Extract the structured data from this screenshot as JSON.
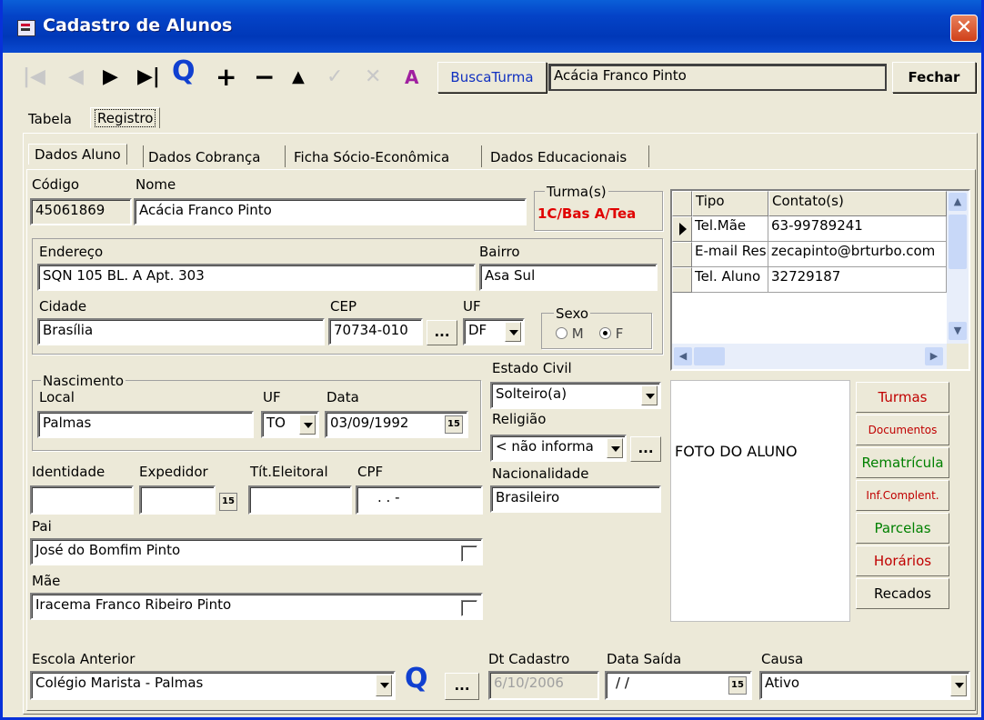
{
  "window": {
    "title": "Cadastro de Alunos",
    "close_glyph": "✕"
  },
  "toolbar": {
    "first": "|◀",
    "prev": "◀",
    "next": "▶",
    "last": "▶|",
    "search_glyph": "Q",
    "add": "+",
    "remove": "−",
    "edit": "▲",
    "confirm": "✓",
    "cancel": "✕",
    "font": "A",
    "busca_turma": "BuscaTurma",
    "current_student": "Acácia Franco Pinto",
    "fechar": "Fechar"
  },
  "view_tabs": {
    "tabela": "Tabela",
    "registro": "Registro"
  },
  "tabs": [
    "Dados Aluno",
    "Dados Cobrança",
    "Ficha Sócio-Econômica",
    "Dados Educacionais"
  ],
  "aluno": {
    "codigo_label": "Código",
    "codigo": "45061869",
    "nome_label": "Nome",
    "nome": "Acácia Franco Pinto",
    "turma_label": "Turma(s)",
    "turma": "1C/Bas A/Tea",
    "endereco_label": "Endereço",
    "endereco": "SQN 105 BL. A Apt. 303",
    "bairro_label": "Bairro",
    "bairro": "Asa Sul",
    "cidade_label": "Cidade",
    "cidade": "Brasília",
    "cep_label": "CEP",
    "cep": "70734-010",
    "uf_label": "UF",
    "uf": "DF",
    "sexo_label": "Sexo",
    "sexo_m": "M",
    "sexo_f": "F",
    "nascimento_label": "Nascimento",
    "local_label": "Local",
    "local": "Palmas",
    "nasc_uf_label": "UF",
    "nasc_uf": "TO",
    "data_label": "Data",
    "data": "03/09/1992",
    "estado_civil_label": "Estado Civil",
    "estado_civil": "Solteiro(a)",
    "religiao_label": "Religião",
    "religiao": "< não informa",
    "identidade_label": "Identidade",
    "identidade": "",
    "expedidor_label": "Expedidor",
    "expedidor": "",
    "titulo_label": "Tít.Eleitoral",
    "titulo": "",
    "cpf_label": "CPF",
    "cpf": ". . -",
    "nacionalidade_label": "Nacionalidade",
    "nacionalidade": "Brasileiro",
    "pai_label": "Pai",
    "pai": "José do Bomfim Pinto",
    "mae_label": "Mãe",
    "mae": "Iracema Franco Ribeiro Pinto",
    "escola_label": "Escola Anterior",
    "escola": "Colégio Marista - Palmas",
    "dt_cadastro_label": "Dt Cadastro",
    "dt_cadastro": "6/10/2006",
    "data_saida_label": "Data Saída",
    "data_saida": "/ /",
    "causa_label": "Causa",
    "causa": "Ativo",
    "dots": "...",
    "cal": "15"
  },
  "contacts": {
    "col_tipo": "Tipo",
    "col_contato": "Contato(s)",
    "rows": [
      {
        "tipo": "Tel.Mãe",
        "contato": "63-99789241"
      },
      {
        "tipo": "E-mail Res",
        "contato": "zecapinto@brturbo.com"
      },
      {
        "tipo": "Tel. Aluno",
        "contato": "32729187"
      }
    ]
  },
  "foto": {
    "label": "FOTO DO ALUNO"
  },
  "side_buttons": [
    {
      "label": "Turmas",
      "color": "#c00000",
      "small": false
    },
    {
      "label": "Documentos",
      "color": "#c00000",
      "small": true
    },
    {
      "label": "Rematrícula",
      "color": "#008000",
      "small": false
    },
    {
      "label": "Inf.Complent.",
      "color": "#c00000",
      "small": true
    },
    {
      "label": "Parcelas",
      "color": "#008000",
      "small": false
    },
    {
      "label": "Horários",
      "color": "#c00000",
      "small": false
    },
    {
      "label": "Recados",
      "color": "#000000",
      "small": false
    }
  ]
}
